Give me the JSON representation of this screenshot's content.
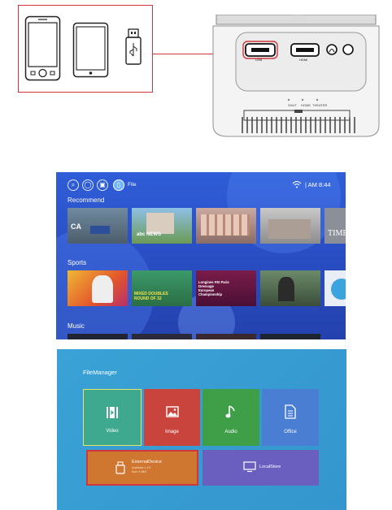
{
  "diagram": {
    "port_labels": [
      "USB",
      "HDMI"
    ],
    "top_buttons": [
      "SHUT",
      "HOME",
      "THEATER"
    ]
  },
  "home": {
    "file_label": "File",
    "time": "| AM 8:44",
    "sections": {
      "recommend": "Recommend",
      "sports": "Sports",
      "music": "Music"
    },
    "recommend_tiles": [
      "CA",
      "abc NEWS",
      "",
      "",
      "TIME"
    ],
    "sports_tiles": [
      "",
      "MIXED DOUBLES\nROUND OF 32",
      "Longines FEI Paris Dressage European Championship",
      "",
      ""
    ]
  },
  "filemanager": {
    "title": "FileManager",
    "tiles": {
      "video": "Video",
      "image": "Image",
      "audio": "Audio",
      "office": "Office",
      "external": "ExternalDevice",
      "external_sub1": "Available 1.1G",
      "external_sub2": "Sum 4.98G",
      "localstore": "LocalStore"
    }
  },
  "colors": {
    "highlight_red": "#d0373d",
    "home_blue": "#2d56cf",
    "fm_blue": "#3a9ed4",
    "video_green": "#3fa98f",
    "image_red": "#c8443d",
    "audio_green": "#3f9f48",
    "office_blue": "#4a7ed3",
    "external_orange": "#cf7630",
    "localstore_purple": "#6a5fbf"
  }
}
